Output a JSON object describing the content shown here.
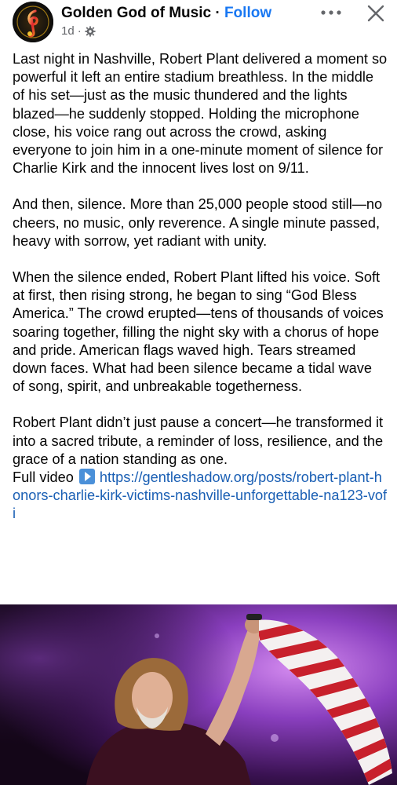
{
  "header": {
    "page_name": "Golden God of Music",
    "separator": "·",
    "follow_label": "Follow",
    "timestamp": "1d",
    "meta_separator": "·",
    "audience_icon": "gear-icon",
    "more_icon": "more-dots-icon",
    "close_icon": "close-icon"
  },
  "post": {
    "paragraphs": [
      "Last night in Nashville, Robert Plant delivered a moment so powerful it left an entire stadium breathless. In the middle of his set—just as the music thundered and the lights blazed—he suddenly stopped. Holding the microphone close, his voice rang out across the crowd, asking everyone to join him in a one-minute moment of silence for Charlie Kirk and the innocent lives lost on 9/11.",
      "And then, silence. More than 25,000 people stood still—no cheers, no music, only reverence. A single minute passed, heavy with sorrow, yet radiant with unity.",
      "When the silence ended, Robert Plant lifted his voice. Soft at first, then rising strong, he began to sing “God Bless America.” The crowd erupted—tens of thousands of voices soaring together, filling the night sky with a chorus of hope and pride. American flags waved high. Tears streamed down faces. What had been silence became a tidal wave of song, spirit, and unbreakable togetherness.",
      "Robert Plant didn’t just pause a concert—he transformed it into a sacred tribute, a reminder of loss, resilience, and the grace of a nation standing as one."
    ],
    "video_label": "Full video",
    "video_icon": "play-button-icon",
    "link_url": "https://gentleshadow.org/posts/robert-plant-honors-charlie-kirk-victims-nashville-unforgettable-na123-vofi"
  },
  "photo": {
    "subject": "singer-raising-flag-image"
  },
  "colors": {
    "follow": "#1877f2",
    "link": "#1a5fb4",
    "meta": "#65676b",
    "stage_purple": "#7a2fa8"
  }
}
